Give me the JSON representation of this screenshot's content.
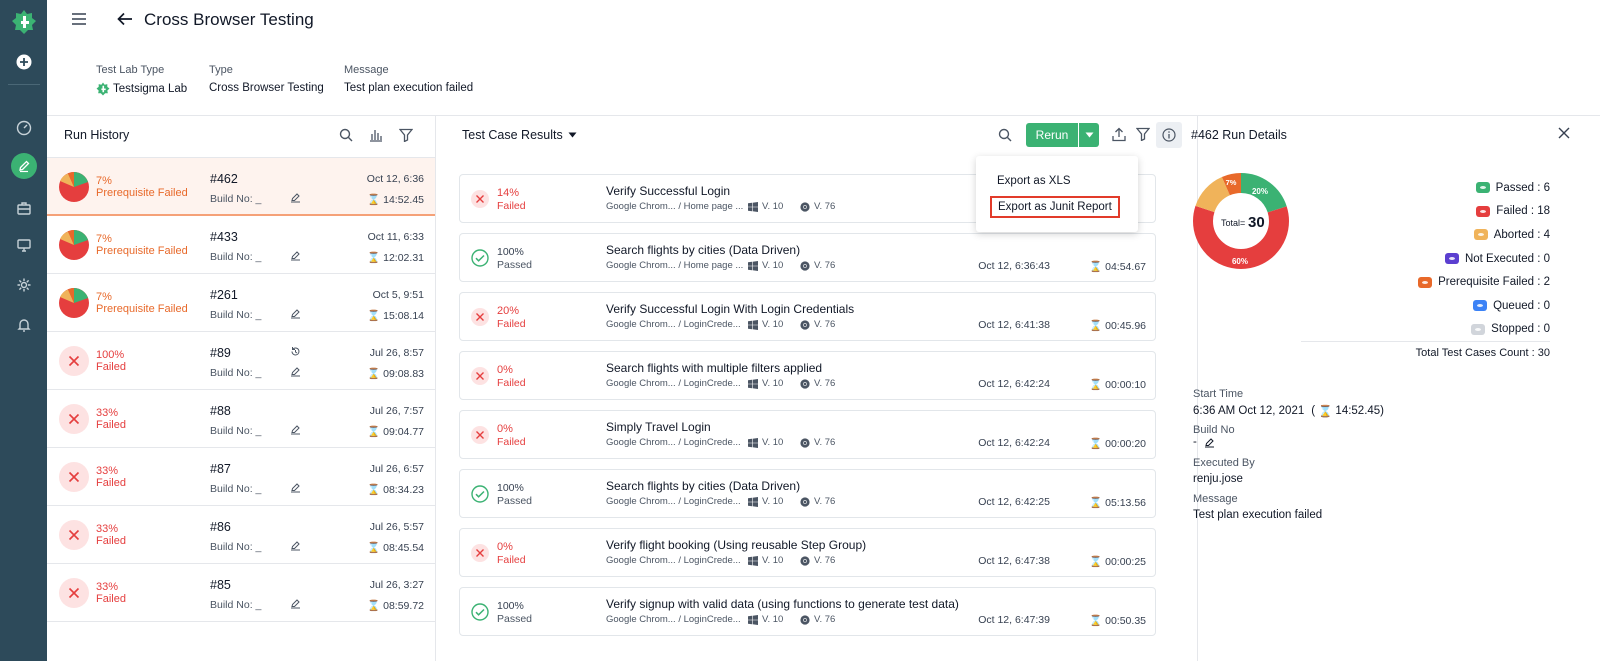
{
  "header": {
    "title": "Cross Browser Testing",
    "meta": [
      {
        "label": "Test Lab Type",
        "value": "Testsigma Lab"
      },
      {
        "label": "Type",
        "value": "Cross Browser Testing"
      },
      {
        "label": "Message",
        "value": "Test plan execution failed"
      }
    ]
  },
  "run_history": {
    "title": "Run History",
    "runs": [
      {
        "pct": "7%",
        "status": "Prerequisite Failed",
        "id": "#462",
        "build": "Build No: _",
        "date": "Oct 12, 6:36",
        "duration": "14:52.45"
      },
      {
        "pct": "7%",
        "status": "Prerequisite Failed",
        "id": "#433",
        "build": "Build No: _",
        "date": "Oct 11, 6:33",
        "duration": "12:02.31"
      },
      {
        "pct": "7%",
        "status": "Prerequisite Failed",
        "id": "#261",
        "build": "Build No: _",
        "date": "Oct 5, 9:51",
        "duration": "15:08.14"
      },
      {
        "pct": "100%",
        "status": "Failed",
        "id": "#89",
        "build": "Build No: _",
        "date": "Jul 26, 8:57",
        "duration": "09:08.83"
      },
      {
        "pct": "33%",
        "status": "Failed",
        "id": "#88",
        "build": "Build No: _",
        "date": "Jul 26, 7:57",
        "duration": "09:04.77"
      },
      {
        "pct": "33%",
        "status": "Failed",
        "id": "#87",
        "build": "Build No: _",
        "date": "Jul 26, 6:57",
        "duration": "08:34.23"
      },
      {
        "pct": "33%",
        "status": "Failed",
        "id": "#86",
        "build": "Build No: _",
        "date": "Jul 26, 5:57",
        "duration": "08:45.54"
      },
      {
        "pct": "33%",
        "status": "Failed",
        "id": "#85",
        "build": "Build No: _",
        "date": "Jul 26, 3:27",
        "duration": "08:59.72"
      }
    ]
  },
  "results": {
    "title": "Test Case Results",
    "rerun_label": "Rerun",
    "export_menu": [
      "Export as XLS",
      "Export as Junit Report"
    ],
    "cases": [
      {
        "pct": "14%",
        "status": "Failed",
        "title": "Verify Successful Login",
        "env": "Google Chrom... / Home page ...",
        "os": "V. 10",
        "browser": "V. 76",
        "date": "",
        "duration": ""
      },
      {
        "pct": "100%",
        "status": "Passed",
        "title": "Search flights by cities (Data Driven)",
        "env": "Google Chrom... / Home page ...",
        "os": "V. 10",
        "browser": "V. 76",
        "date": "Oct 12, 6:36:43",
        "duration": "04:54.67"
      },
      {
        "pct": "20%",
        "status": "Failed",
        "title": "Verify Successful Login With Login Credentials",
        "env": "Google Chrom... / LoginCrede...",
        "os": "V. 10",
        "browser": "V. 76",
        "date": "Oct 12, 6:41:38",
        "duration": "00:45.96"
      },
      {
        "pct": "0%",
        "status": "Failed",
        "title": "Search flights with multiple filters applied",
        "env": "Google Chrom... / LoginCrede...",
        "os": "V. 10",
        "browser": "V. 76",
        "date": "Oct 12, 6:42:24",
        "duration": "00:00:10"
      },
      {
        "pct": "0%",
        "status": "Failed",
        "title": "Simply Travel Login",
        "env": "Google Chrom... / LoginCrede...",
        "os": "V. 10",
        "browser": "V. 76",
        "date": "Oct 12, 6:42:24",
        "duration": "00:00:20"
      },
      {
        "pct": "100%",
        "status": "Passed",
        "title": "Search flights by cities (Data Driven)",
        "env": "Google Chrom... / LoginCrede...",
        "os": "V. 10",
        "browser": "V. 76",
        "date": "Oct 12, 6:42:25",
        "duration": "05:13.56"
      },
      {
        "pct": "0%",
        "status": "Failed",
        "title": "Verify flight booking (Using reusable Step Group)",
        "env": "Google Chrom... / LoginCrede...",
        "os": "V. 10",
        "browser": "V. 76",
        "date": "Oct 12, 6:47:38",
        "duration": "00:00:25"
      },
      {
        "pct": "100%",
        "status": "Passed",
        "title": "Verify signup with valid data (using functions to generate test data)",
        "env": "Google Chrom... / LoginCrede...",
        "os": "V. 10",
        "browser": "V. 76",
        "date": "Oct 12, 6:47:39",
        "duration": "00:50.35"
      }
    ]
  },
  "details": {
    "title": "#462 Run Details",
    "donut": {
      "total_label": "Total=",
      "total": "30",
      "labels": [
        "20%",
        "60%",
        "7%"
      ]
    },
    "legend": [
      {
        "label": "Passed : 6",
        "color": "#3bb273"
      },
      {
        "label": "Failed : 18",
        "color": "#e53e3e"
      },
      {
        "label": "Aborted : 4",
        "color": "#f0b35a"
      },
      {
        "label": "Not Executed : 0",
        "color": "#5b3fd0"
      },
      {
        "label": "Prerequisite Failed : 2",
        "color": "#e8692a"
      },
      {
        "label": "Queued : 0",
        "color": "#3b82f6"
      },
      {
        "label": "Stopped : 0",
        "color": "#d1d5db"
      }
    ],
    "total_cases": "Total Test Cases Count : 30",
    "start_label": "Start Time",
    "start_value": "6:36 AM Oct 12, 2021",
    "start_duration": "14:52.45)",
    "build_label": "Build No",
    "build_value": "-",
    "executed_label": "Executed By",
    "executed_value": "renju.jose",
    "message_label": "Message",
    "message_value": "Test plan execution failed"
  }
}
